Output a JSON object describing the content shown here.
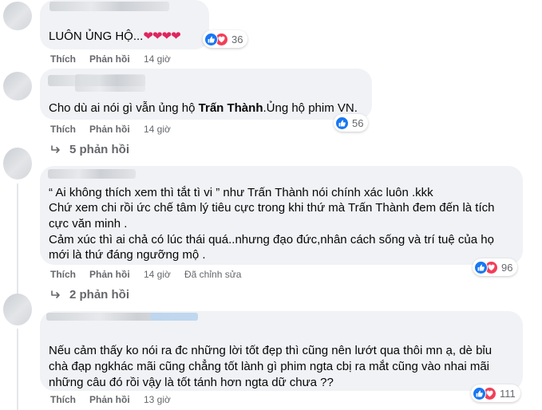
{
  "actions": {
    "like": "Thích",
    "reply": "Phản hồi",
    "edited": "Đã chỉnh sửa"
  },
  "comments": [
    {
      "text": [
        "LUÔN ỦNG HỘ..."
      ],
      "time": "14 giờ",
      "reaction_count": "36"
    },
    {
      "text_before": "Cho dù ai nói gì vẫn ủng hộ ",
      "text_bold": "Trấn Thành",
      "text_after": ".Ủng hộ phim VN.",
      "time": "14 giờ",
      "reaction_count": "56",
      "replies_label": "5 phản hồi"
    },
    {
      "text": [
        "“ Ai không thích xem thì tắt tì vi ” như Trấn Thành nói chính xác luôn .kkk",
        "Chứ xem chi rồi ức chế tâm lý tiêu cực trong khi thứ mà Trấn Thành đem đến là tích",
        "cực văn minh .",
        "Cảm xúc thì ai chả có lúc thái quá..nhưng đạo đức,nhân cách sống và trí tuệ của họ",
        "mới là thứ đáng ngưỡng mộ ."
      ],
      "time": "14 giờ",
      "reaction_count": "96",
      "replies_label": "2 phản hồi"
    },
    {
      "text": [
        "Nếu cảm thấy ko nói ra đc những lời tốt đẹp thì cũng nên lướt qua thôi mn ạ, dè bỉu",
        "chà đạp ngkhác mãi cũng chẳng tốt lành gì phim ngta cbị ra mắt cũng vào nhai mãi",
        "những câu đó rồi vậy là tốt tánh hơn ngta dữ chưa ??"
      ],
      "time": "13 giờ",
      "reaction_count": "111"
    }
  ],
  "colors": {
    "bubble": "#f0f2f5",
    "like": "#1877f2",
    "love": "#f33e58",
    "meta": "#65676b"
  }
}
